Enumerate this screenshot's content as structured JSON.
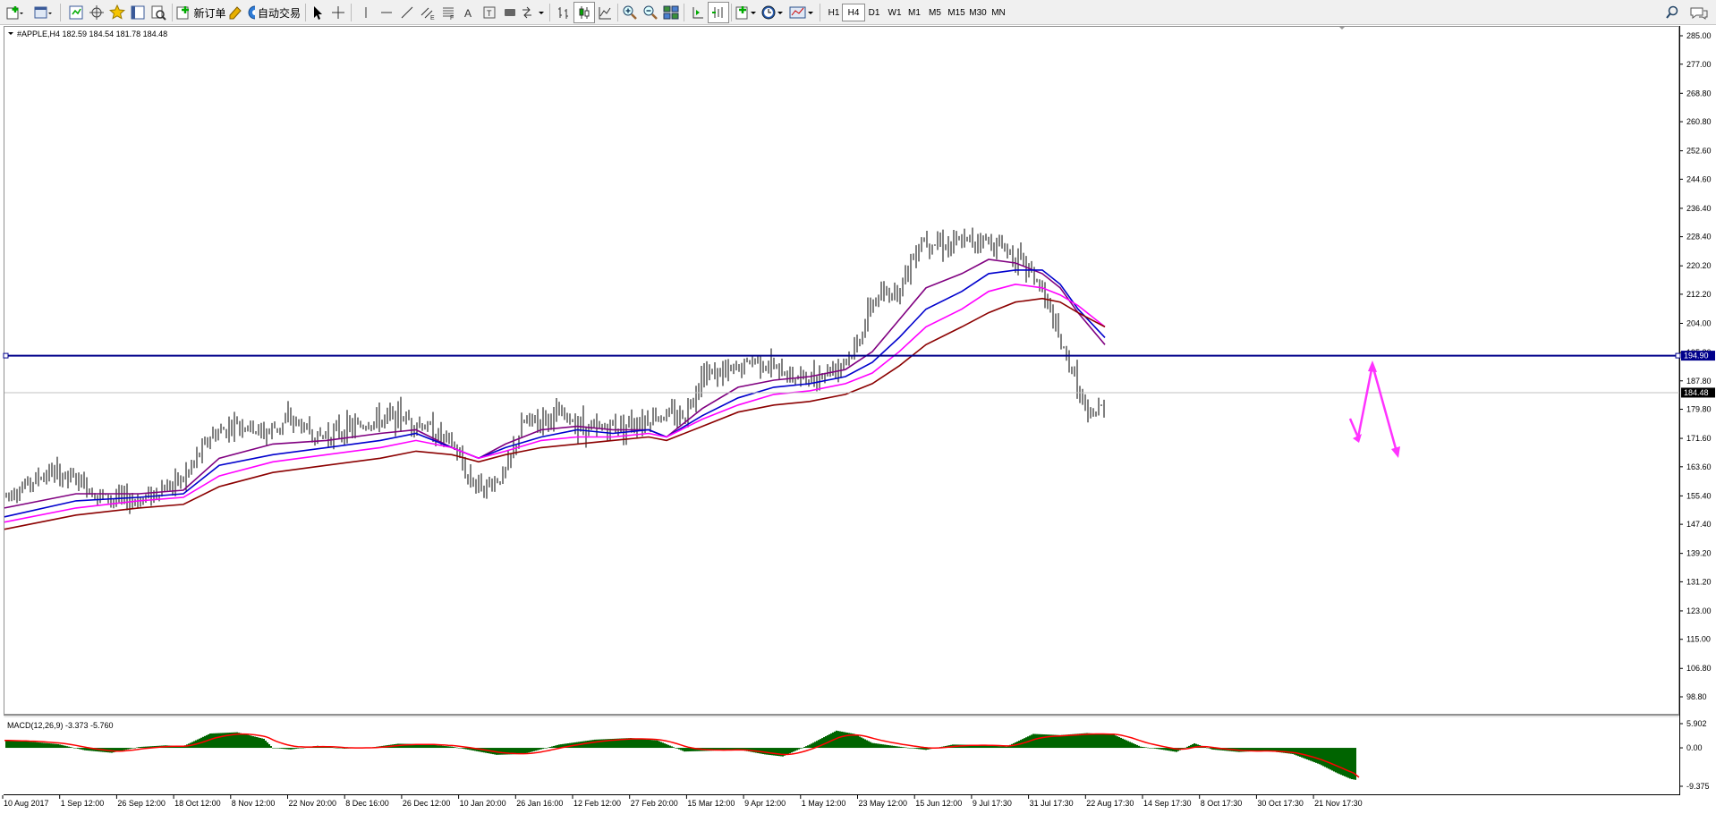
{
  "toolbar": {
    "new_order_label": "新订单",
    "auto_trading_label": "自动交易",
    "timeframes": [
      "H1",
      "H4",
      "D1",
      "W1",
      "M1",
      "M5",
      "M15",
      "M30",
      "MN"
    ],
    "active_timeframe": "H4"
  },
  "chart": {
    "symbol_info": "#APPLE,H4  182.59 184.54 181.78 184.48",
    "price_axis": {
      "labels": [
        "285.00",
        "277.00",
        "268.80",
        "260.80",
        "252.60",
        "244.60",
        "236.40",
        "228.40",
        "220.20",
        "212.20",
        "204.00",
        "195.80",
        "187.80",
        "179.80",
        "171.60",
        "163.60",
        "155.40",
        "147.40",
        "139.20",
        "131.20",
        "123.00",
        "115.00",
        "106.80",
        "98.80"
      ],
      "range": [
        98.8,
        285.0
      ]
    },
    "horizontal_line_price": "194.90",
    "current_price": "184.48",
    "colors": {
      "candles": "#000000",
      "ma_purple": "#800080",
      "ma_blue": "#0000cd",
      "ma_magenta": "#ff00ff",
      "ma_brown": "#8b0000",
      "horizontal_line": "#00008b",
      "bid_line": "#c0c0c0",
      "forecast_arrow": "#ff33ff",
      "macd_histogram": "#006400",
      "macd_signal": "#ff0000"
    }
  },
  "indicator": {
    "label": "MACD(12,26,9) -3.373 -5.760",
    "scale_labels": [
      "5.902",
      "0.00",
      "-9.375"
    ],
    "range": [
      -9.375,
      5.902
    ]
  },
  "time_axis": {
    "labels": [
      "10 Aug 2017",
      "1 Sep 12:00",
      "26 Sep 12:00",
      "18 Oct 12:00",
      "8 Nov 12:00",
      "22 Nov 20:00",
      "8 Dec 16:00",
      "26 Dec 12:00",
      "10 Jan 20:00",
      "26 Jan 16:00",
      "12 Feb 12:00",
      "27 Feb 20:00",
      "15 Mar 12:00",
      "9 Apr 12:00",
      "1 May 12:00",
      "23 May 12:00",
      "15 Jun 12:00",
      "9 Jul 17:30",
      "31 Jul 17:30",
      "22 Aug 17:30",
      "14 Sep 17:30",
      "8 Oct 17:30",
      "30 Oct 17:30",
      "21 Nov 17:30"
    ]
  },
  "chart_data": {
    "type": "line",
    "series": [
      {
        "values": [
          [
            0,
            155.5
          ],
          [
            50,
            162
          ],
          [
            80,
            160
          ],
          [
            110,
            155
          ],
          [
            150,
            154
          ],
          [
            180,
            158
          ],
          [
            200,
            160
          ],
          [
            230,
            172
          ],
          [
            260,
            176
          ],
          [
            290,
            173
          ],
          [
            320,
            177
          ],
          [
            350,
            172
          ],
          [
            380,
            174
          ],
          [
            410,
            176
          ],
          [
            440,
            178
          ],
          [
            470,
            175
          ],
          [
            500,
            170
          ],
          [
            520,
            160
          ],
          [
            540,
            158
          ],
          [
            560,
            162
          ],
          [
            580,
            176
          ],
          [
            620,
            178
          ],
          [
            660,
            174
          ],
          [
            700,
            176
          ],
          [
            730,
            178
          ],
          [
            760,
            178
          ],
          [
            780,
            190
          ],
          [
            810,
            190
          ],
          [
            840,
            194
          ],
          [
            870,
            190
          ],
          [
            900,
            188
          ],
          [
            930,
            192
          ],
          [
            950,
            196
          ],
          [
            970,
            210
          ],
          [
            1000,
            214
          ],
          [
            1025,
            228
          ],
          [
            1060,
            226
          ],
          [
            1090,
            228
          ],
          [
            1120,
            225
          ],
          [
            1150,
            218
          ],
          [
            1165,
            210
          ],
          [
            1180,
            198
          ],
          [
            1195,
            190
          ],
          [
            1210,
            177
          ],
          [
            1230,
            181
          ]
        ]
      },
      {
        "values": [
          [
            0,
            152
          ],
          [
            80,
            156
          ],
          [
            150,
            156
          ],
          [
            200,
            157
          ],
          [
            240,
            166
          ],
          [
            300,
            170
          ],
          [
            360,
            171
          ],
          [
            420,
            173
          ],
          [
            460,
            174
          ],
          [
            500,
            169
          ],
          [
            530,
            166
          ],
          [
            560,
            170
          ],
          [
            600,
            174
          ],
          [
            640,
            175
          ],
          [
            680,
            174
          ],
          [
            720,
            174
          ],
          [
            740,
            172
          ],
          [
            780,
            180
          ],
          [
            820,
            186
          ],
          [
            860,
            188
          ],
          [
            900,
            189
          ],
          [
            940,
            191
          ],
          [
            970,
            196
          ],
          [
            1000,
            205
          ],
          [
            1030,
            214
          ],
          [
            1070,
            218
          ],
          [
            1100,
            222
          ],
          [
            1130,
            221
          ],
          [
            1160,
            218
          ],
          [
            1180,
            214
          ],
          [
            1200,
            207
          ],
          [
            1230,
            198
          ]
        ]
      },
      {
        "values": [
          [
            0,
            149.5
          ],
          [
            80,
            154
          ],
          [
            150,
            155
          ],
          [
            200,
            156
          ],
          [
            240,
            164
          ],
          [
            300,
            167
          ],
          [
            360,
            169
          ],
          [
            420,
            171
          ],
          [
            460,
            173
          ],
          [
            500,
            169
          ],
          [
            530,
            166
          ],
          [
            560,
            169
          ],
          [
            600,
            172
          ],
          [
            640,
            174
          ],
          [
            680,
            173
          ],
          [
            720,
            174
          ],
          [
            740,
            172
          ],
          [
            780,
            178
          ],
          [
            820,
            183
          ],
          [
            860,
            186
          ],
          [
            900,
            187
          ],
          [
            940,
            189
          ],
          [
            970,
            193
          ],
          [
            1000,
            200
          ],
          [
            1030,
            208
          ],
          [
            1070,
            213
          ],
          [
            1100,
            218
          ],
          [
            1130,
            219
          ],
          [
            1160,
            219
          ],
          [
            1180,
            215
          ],
          [
            1200,
            208
          ],
          [
            1230,
            200
          ]
        ]
      },
      {
        "values": [
          [
            0,
            148
          ],
          [
            80,
            152
          ],
          [
            150,
            154
          ],
          [
            200,
            155
          ],
          [
            240,
            161
          ],
          [
            300,
            165
          ],
          [
            360,
            167
          ],
          [
            420,
            169
          ],
          [
            460,
            171
          ],
          [
            500,
            169
          ],
          [
            530,
            166
          ],
          [
            560,
            168
          ],
          [
            600,
            171
          ],
          [
            640,
            172
          ],
          [
            680,
            172
          ],
          [
            720,
            173
          ],
          [
            740,
            172
          ],
          [
            780,
            177
          ],
          [
            820,
            181
          ],
          [
            860,
            184
          ],
          [
            900,
            185
          ],
          [
            940,
            187
          ],
          [
            970,
            190
          ],
          [
            1000,
            196
          ],
          [
            1030,
            203
          ],
          [
            1070,
            208
          ],
          [
            1100,
            213
          ],
          [
            1130,
            215
          ],
          [
            1160,
            214
          ],
          [
            1180,
            212
          ],
          [
            1200,
            209
          ],
          [
            1230,
            203
          ]
        ]
      },
      {
        "values": [
          [
            0,
            146
          ],
          [
            80,
            150
          ],
          [
            150,
            152
          ],
          [
            200,
            153
          ],
          [
            240,
            158
          ],
          [
            300,
            162
          ],
          [
            360,
            164
          ],
          [
            420,
            166
          ],
          [
            460,
            168
          ],
          [
            500,
            167
          ],
          [
            530,
            165
          ],
          [
            560,
            167
          ],
          [
            600,
            169
          ],
          [
            640,
            170
          ],
          [
            680,
            171
          ],
          [
            720,
            172
          ],
          [
            740,
            171
          ],
          [
            780,
            175
          ],
          [
            820,
            179
          ],
          [
            860,
            181
          ],
          [
            900,
            182
          ],
          [
            940,
            184
          ],
          [
            970,
            187
          ],
          [
            1000,
            192
          ],
          [
            1030,
            198
          ],
          [
            1070,
            203
          ],
          [
            1100,
            207
          ],
          [
            1130,
            210
          ],
          [
            1160,
            211
          ],
          [
            1180,
            210
          ],
          [
            1200,
            207
          ],
          [
            1230,
            203
          ]
        ]
      }
    ],
    "ylim": [
      98.8,
      285.0
    ]
  }
}
